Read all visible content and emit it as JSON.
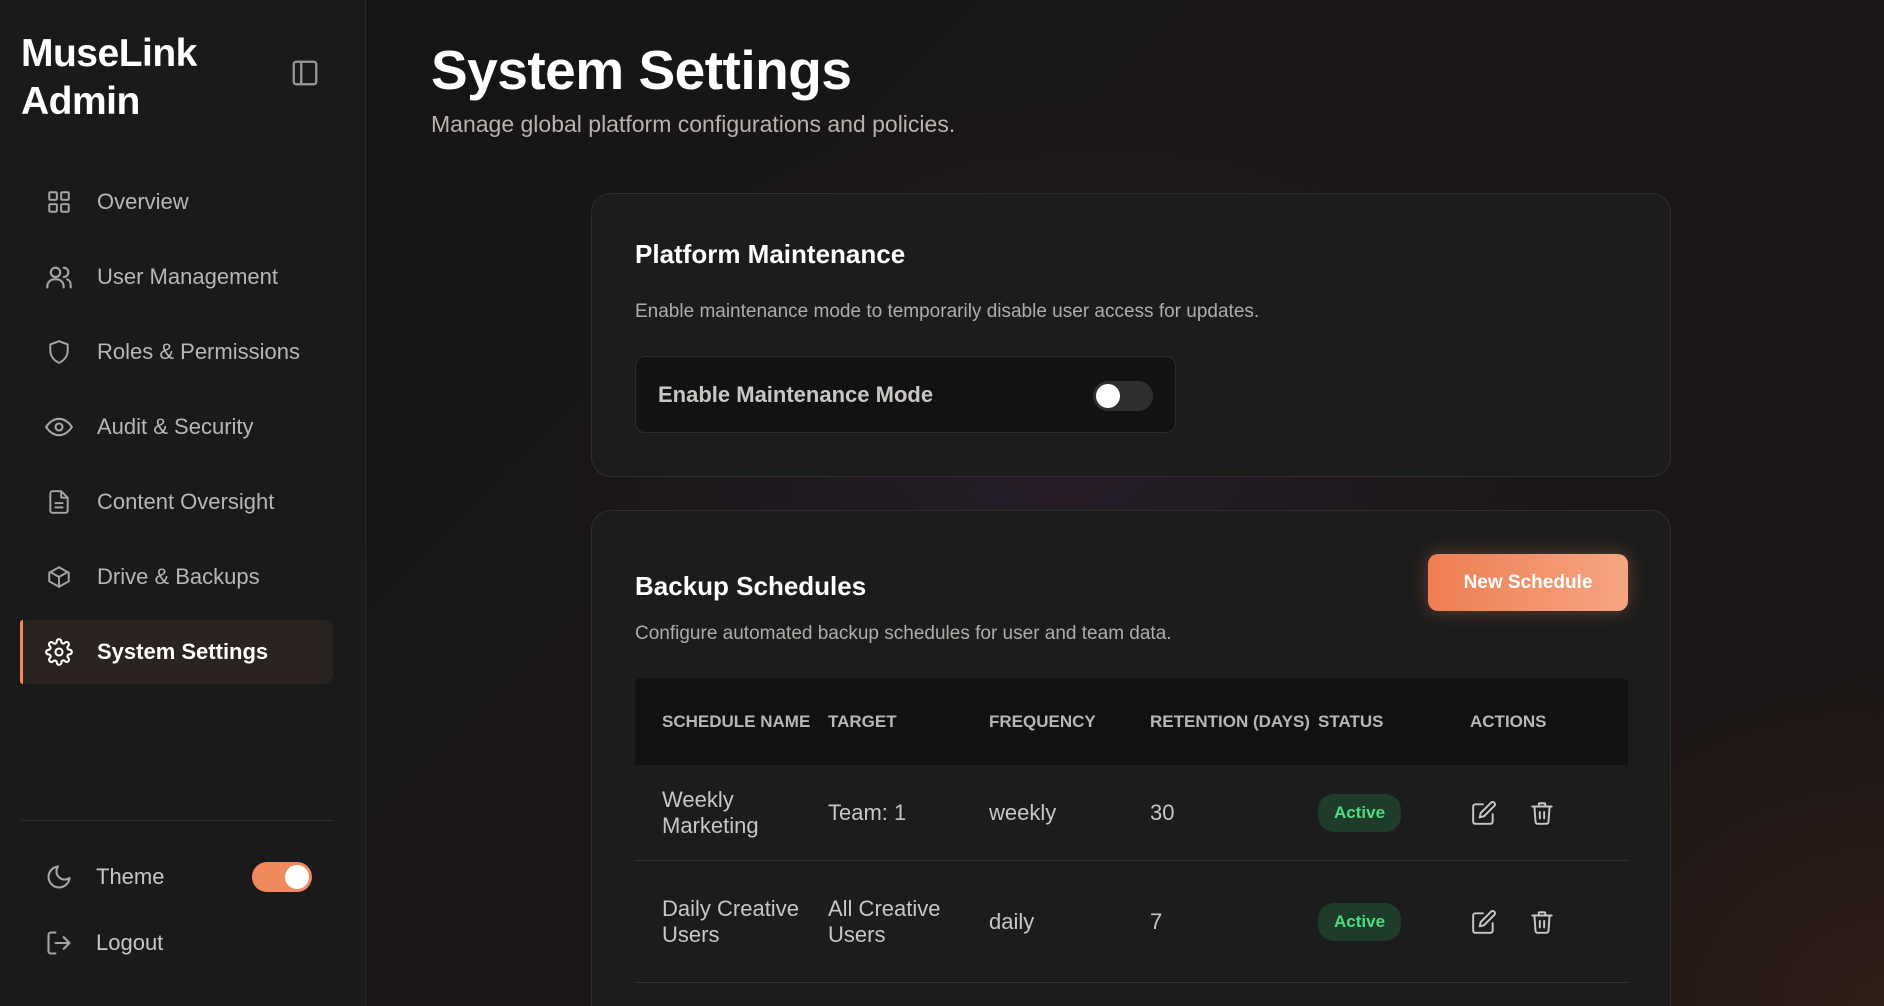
{
  "sidebar": {
    "brand_line1": "MuseLink",
    "brand_line2": "Admin",
    "items": [
      {
        "label": "Overview",
        "icon": "grid-icon"
      },
      {
        "label": "User Management",
        "icon": "users-icon"
      },
      {
        "label": "Roles & Permissions",
        "icon": "shield-icon"
      },
      {
        "label": "Audit & Security",
        "icon": "eye-icon"
      },
      {
        "label": "Content Oversight",
        "icon": "file-icon"
      },
      {
        "label": "Drive & Backups",
        "icon": "box-icon"
      },
      {
        "label": "System Settings",
        "icon": "gear-icon",
        "active": true
      }
    ],
    "theme_label": "Theme",
    "theme_on": true,
    "logout_label": "Logout"
  },
  "page": {
    "title": "System Settings",
    "subtitle": "Manage global platform configurations and policies."
  },
  "maintenance": {
    "title": "Platform Maintenance",
    "description": "Enable maintenance mode to temporarily disable user access for updates.",
    "toggle_label": "Enable Maintenance Mode",
    "enabled": false
  },
  "backups": {
    "title": "Backup Schedules",
    "description": "Configure automated backup schedules for user and team data.",
    "new_button": "New Schedule",
    "columns": {
      "name": "Schedule Name",
      "target": "Target",
      "frequency": "Frequency",
      "retention": "Retention (Days)",
      "status": "Status",
      "actions": "Actions"
    },
    "rows": [
      {
        "name": "Weekly Marketing",
        "target": "Team: 1",
        "frequency": "weekly",
        "retention": "30",
        "status": "Active"
      },
      {
        "name": "Daily Creative Users",
        "target": "All Creative Users",
        "frequency": "daily",
        "retention": "7",
        "status": "Active"
      }
    ]
  },
  "colors": {
    "accent": "#f08a5d",
    "status_active": "#4ade80"
  }
}
